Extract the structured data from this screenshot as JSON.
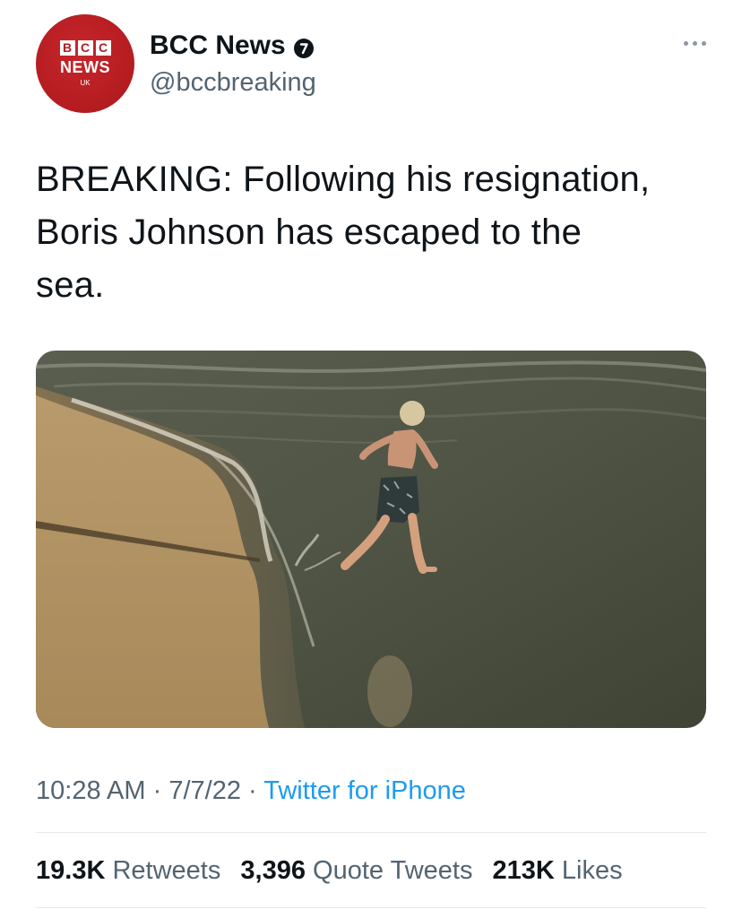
{
  "account": {
    "name": "BCC News",
    "handle": "@bccbreaking",
    "avatar": {
      "blocks": [
        "B",
        "C",
        "C"
      ],
      "line1": "NEWS",
      "line2": "UK",
      "color": "#b31c20"
    },
    "verified_icon": "verified-badge-icon"
  },
  "tweet": {
    "text": "BREAKING: Following his resignation, Boris Johnson has escaped to the sea.",
    "lines": [
      "BREAKING: Following his resignation,",
      "Boris Johnson has escaped to the",
      "sea."
    ]
  },
  "media": {
    "icon": "beach-photo"
  },
  "meta": {
    "time": "10:28 AM",
    "separator": "·",
    "date": "7/7/22",
    "source": "Twitter for iPhone"
  },
  "stats": {
    "retweets_count": "19.3K",
    "retweets_label": "Retweets",
    "quotes_count": "3,396",
    "quotes_label": "Quote Tweets",
    "likes_count": "213K",
    "likes_label": "Likes"
  },
  "colors": {
    "text": "#0f1419",
    "secondary": "#536471",
    "link": "#1d9bf0",
    "divider": "#e6e9eb"
  }
}
